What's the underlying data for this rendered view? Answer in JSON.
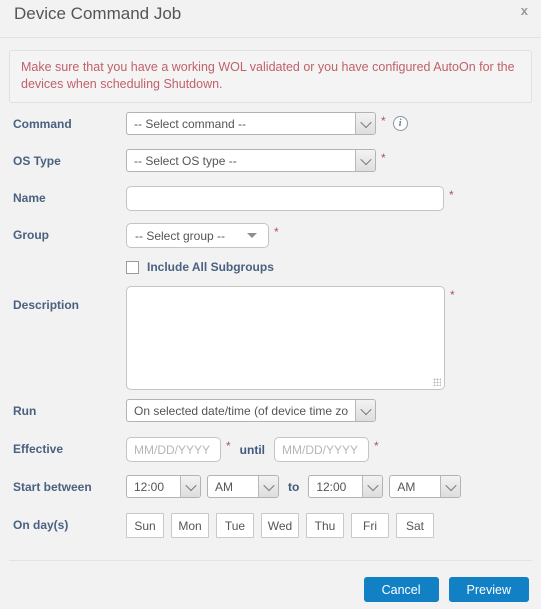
{
  "dialog": {
    "title": "Device Command Job",
    "close_label": "x",
    "close_icon": "close-icon"
  },
  "warning": {
    "text": "Make sure that you have a working WOL validated or you have configured AutoOn for the devices when scheduling Shutdown."
  },
  "form": {
    "command": {
      "label": "Command",
      "value": "-- Select command --",
      "required_marker": "*",
      "info_icon": "info-icon"
    },
    "os_type": {
      "label": "OS Type",
      "value": "-- Select OS type --",
      "required_marker": "*"
    },
    "name": {
      "label": "Name",
      "value": "",
      "placeholder": "",
      "required_marker": "*"
    },
    "group": {
      "label": "Group",
      "value": "-- Select group --",
      "required_marker": "*",
      "dropdown_icon": "triangle-down-icon"
    },
    "include_all_subgroups": {
      "label": "Include All Subgroups",
      "checked": false
    },
    "description": {
      "label": "Description",
      "value": "",
      "placeholder": "",
      "required_marker": "*"
    },
    "run": {
      "label": "Run",
      "value": "On selected date/time (of device time zo"
    },
    "effective": {
      "label": "Effective",
      "from_placeholder": "MM/DD/YYYY",
      "from_value": "",
      "from_required": "*",
      "until_label": "until",
      "to_placeholder": "MM/DD/YYYY",
      "to_value": "",
      "to_required": "*"
    },
    "start_between": {
      "label": "Start between",
      "from_time": "12:00",
      "from_meridiem": "AM",
      "to_word": "to",
      "to_time": "12:00",
      "to_meridiem": "AM"
    },
    "on_days": {
      "label": "On day(s)",
      "days": [
        "Sun",
        "Mon",
        "Tue",
        "Wed",
        "Thu",
        "Fri",
        "Sat"
      ]
    }
  },
  "footer": {
    "cancel_label": "Cancel",
    "preview_label": "Preview"
  },
  "colors": {
    "accent_blue": "#1180c4",
    "label_blue": "#4a6180",
    "warning_red": "#c0616b",
    "required_red": "#b5505a",
    "background": "#f2f2f2"
  }
}
